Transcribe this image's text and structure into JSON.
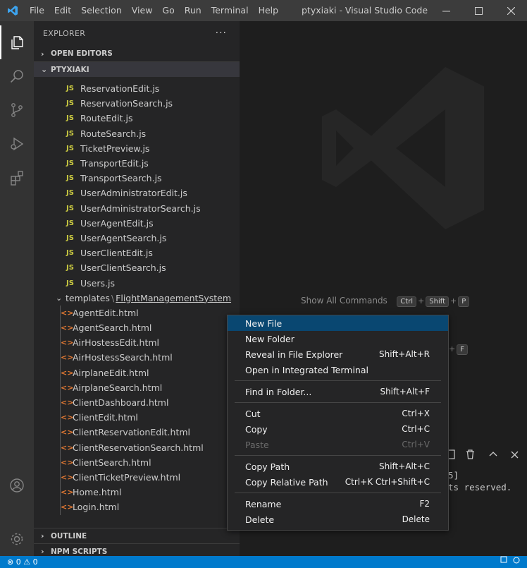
{
  "app": {
    "window_title": "ptyxiaki - Visual Studio Code",
    "menu": [
      "File",
      "Edit",
      "Selection",
      "View",
      "Go",
      "Run",
      "Terminal",
      "Help"
    ]
  },
  "sidebar": {
    "title": "EXPLORER",
    "more_label": "···",
    "open_editors_label": "OPEN EDITORS",
    "project_label": "PTYXIAKI",
    "js_icon_label": "JS",
    "html_icon_label": "<>",
    "js_files": [
      "ReservationEdit.js",
      "ReservationSearch.js",
      "RouteEdit.js",
      "RouteSearch.js",
      "TicketPreview.js",
      "TransportEdit.js",
      "TransportSearch.js",
      "UserAdministratorEdit.js",
      "UserAdministratorSearch.js",
      "UserAgentEdit.js",
      "UserAgentSearch.js",
      "UserClientEdit.js",
      "UserClientSearch.js",
      "Users.js"
    ],
    "folder": {
      "prefix": "templates",
      "sep": "\\",
      "name": "FlightManagementSystem"
    },
    "html_files": [
      "AgentEdit.html",
      "AgentSearch.html",
      "AirHostessEdit.html",
      "AirHostessSearch.html",
      "AirplaneEdit.html",
      "AirplaneSearch.html",
      "ClientDashboard.html",
      "ClientEdit.html",
      "ClientReservationEdit.html",
      "ClientReservationSearch.html",
      "ClientSearch.html",
      "ClientTicketPreview.html",
      "Home.html",
      "Login.html"
    ],
    "outline_label": "OUTLINE",
    "npm_label": "NPM SCRIPTS"
  },
  "editor": {
    "hint_label": "Show All Commands",
    "hint_keys": [
      "Ctrl",
      "Shift",
      "P"
    ],
    "hint2_key": "F",
    "terminal_lines": [
      "5]",
      "ts reserved."
    ]
  },
  "context_menu": {
    "groups": [
      [
        {
          "label": "New File",
          "shortcut": "",
          "active": true
        },
        {
          "label": "New Folder",
          "shortcut": ""
        },
        {
          "label": "Reveal in File Explorer",
          "shortcut": "Shift+Alt+R"
        },
        {
          "label": "Open in Integrated Terminal",
          "shortcut": ""
        }
      ],
      [
        {
          "label": "Find in Folder...",
          "shortcut": "Shift+Alt+F"
        }
      ],
      [
        {
          "label": "Cut",
          "shortcut": "Ctrl+X"
        },
        {
          "label": "Copy",
          "shortcut": "Ctrl+C"
        },
        {
          "label": "Paste",
          "shortcut": "Ctrl+V",
          "disabled": true
        }
      ],
      [
        {
          "label": "Copy Path",
          "shortcut": "Shift+Alt+C"
        },
        {
          "label": "Copy Relative Path",
          "shortcut": "Ctrl+K Ctrl+Shift+C"
        }
      ],
      [
        {
          "label": "Rename",
          "shortcut": "F2"
        },
        {
          "label": "Delete",
          "shortcut": "Delete"
        }
      ]
    ]
  },
  "statusbar": {
    "errors": "0",
    "warnings": "0",
    "left_text": "⊗ 0 ⚠ 0"
  },
  "colors": {
    "accent": "#007acc",
    "menu_highlight": "#094771",
    "js_icon": "#cbcb41",
    "html_icon": "#e37933"
  }
}
